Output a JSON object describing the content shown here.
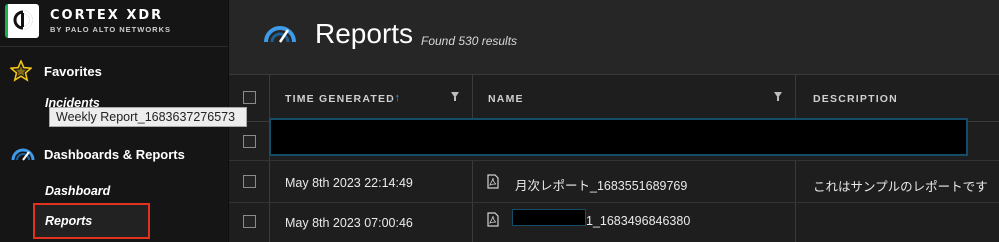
{
  "brand": {
    "title": "CORTEX XDR",
    "subtitle": "BY PALO ALTO NETWORKS"
  },
  "sidebar": {
    "favorites_label": "Favorites",
    "incidents_label": "Incidents",
    "tooltip": "Weekly Report_1683637276573",
    "section_label": "Dashboards & Reports",
    "dashboard_label": "Dashboard",
    "reports_label": "Reports",
    "active_item": "Reports"
  },
  "page": {
    "title": "Reports",
    "result_count": "Found 530 results"
  },
  "table": {
    "columns": [
      "TIME GENERATED",
      "NAME",
      "DESCRIPTION"
    ],
    "rows": [
      {
        "time": "May 8th 2023 22:14:49",
        "name": "月次レポート_1683551689769",
        "description": "これはサンプルのレポートです"
      },
      {
        "time": "May 8th 2023 07:00:46",
        "name": "1_1683496846380",
        "description": ""
      }
    ]
  },
  "colors": {
    "sidebar_bg": "#151515",
    "main_bg": "#262626",
    "accent_blue": "#3d9be9",
    "highlight_red": "#e0321f",
    "favorite_star": "#f2c318"
  }
}
